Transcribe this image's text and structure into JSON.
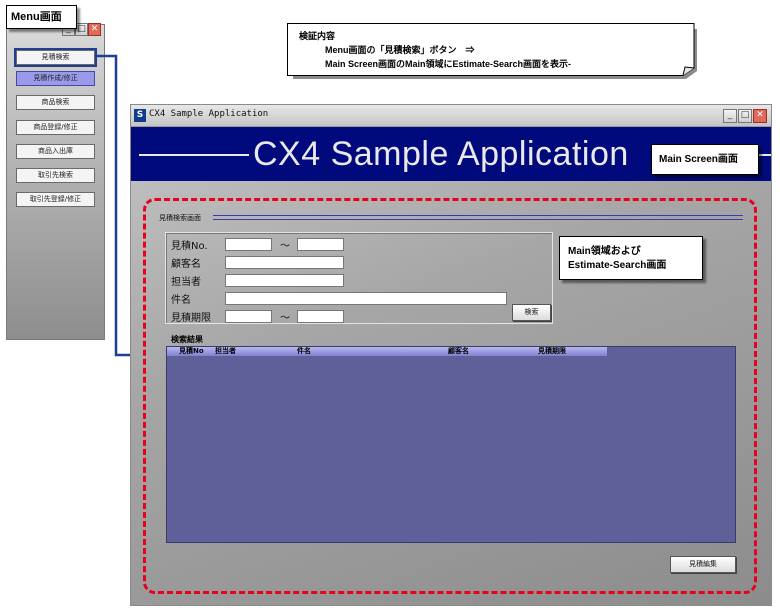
{
  "menu_window": {
    "callout_label": "Menu画面",
    "controls": {
      "minimize": "_",
      "maximize": "□",
      "close": "✕"
    },
    "items": [
      {
        "label": "見積検索",
        "state": "selected"
      },
      {
        "label": "見積作成/修正",
        "state": "active"
      },
      {
        "label": "商品検索",
        "state": "normal"
      },
      {
        "label": "商品登録/修正",
        "state": "normal"
      },
      {
        "label": "商品入出庫",
        "state": "normal"
      },
      {
        "label": "取引先検索",
        "state": "normal"
      },
      {
        "label": "取引先登録/修正",
        "state": "normal"
      }
    ]
  },
  "verification_note": {
    "title": "検証内容",
    "line1": "Menu画面の「見積検索」ボタン　⇒",
    "line2": "Main Screen画面のMain領域にEstimate-Search画面を表示-"
  },
  "main_window": {
    "title": "CX4 Sample Application",
    "app_icon": "S",
    "controls": {
      "minimize": "_",
      "maximize": "□",
      "close": "✕"
    },
    "banner_title": "CX4 Sample Application",
    "callout_label": "Main Screen画面",
    "region_callout": {
      "line1": "Main領域および",
      "line2": "Estimate-Search画面"
    },
    "search_screen": {
      "group_title": "見積検索画面",
      "fields": {
        "estimate_no": "見積No.",
        "customer_name": "顧客名",
        "person_in_charge": "担当者",
        "subject": "件名",
        "deadline": "見積期限"
      },
      "range_separator": "～",
      "search_button": "検索",
      "results_label": "検索結果",
      "columns": [
        "見積No",
        "担当者",
        "件名",
        "顧客名",
        "見積期限"
      ],
      "edit_button": "見積編集"
    },
    "colors": {
      "banner": "#000a7d",
      "results_grid": "#5f5f9a",
      "header_bar": "#8f8fd8",
      "dashed_outline": "#e8001c"
    }
  }
}
